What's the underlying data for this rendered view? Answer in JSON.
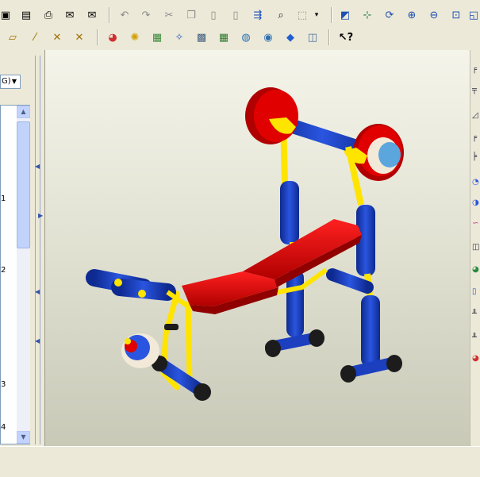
{
  "toolbar_top": {
    "items": [
      {
        "name": "new-window-icon",
        "glyph": "▣"
      },
      {
        "name": "save-icon",
        "glyph": "▤"
      },
      {
        "name": "print-icon",
        "glyph": "⎙"
      },
      {
        "name": "send-mail-icon",
        "glyph": "✉"
      },
      {
        "name": "email-attach-icon",
        "glyph": "✉"
      },
      {
        "name": "undo-icon",
        "glyph": "↶"
      },
      {
        "name": "redo-icon",
        "glyph": "↷"
      },
      {
        "name": "cut-icon",
        "glyph": "✂"
      },
      {
        "name": "copy-icon",
        "glyph": "❐"
      },
      {
        "name": "paste-icon",
        "glyph": "▯"
      },
      {
        "name": "paste-special-icon",
        "glyph": "▯"
      },
      {
        "name": "regenerate-icon",
        "glyph": "⇶"
      },
      {
        "name": "find-icon",
        "glyph": "⌕"
      },
      {
        "name": "select-box-icon",
        "glyph": "⬚"
      },
      {
        "name": "select-dropdown-icon",
        "glyph": "▾"
      },
      {
        "name": "redraw-icon",
        "glyph": "◩"
      },
      {
        "name": "spin-center-icon",
        "glyph": "⊹"
      },
      {
        "name": "orient-mode-icon",
        "glyph": "⟳"
      },
      {
        "name": "zoom-in-icon",
        "glyph": "⊕"
      },
      {
        "name": "zoom-out-icon",
        "glyph": "⊖"
      },
      {
        "name": "refit-icon",
        "glyph": "⊡"
      },
      {
        "name": "reorient-icon",
        "glyph": "◱"
      }
    ]
  },
  "toolbar_second": {
    "items": [
      {
        "name": "datum-plane-icon",
        "glyph": "▱"
      },
      {
        "name": "datum-axis-icon",
        "glyph": "⁄"
      },
      {
        "name": "datum-point-icon",
        "glyph": "✕"
      },
      {
        "name": "coordinate-system-icon",
        "glyph": "✕"
      },
      {
        "name": "appearance-icon",
        "glyph": "◕"
      },
      {
        "name": "light-icon",
        "glyph": "✺"
      },
      {
        "name": "scene-icon",
        "glyph": "▦"
      },
      {
        "name": "render-tool-icon",
        "glyph": "✧"
      },
      {
        "name": "render-window-icon",
        "glyph": "▩"
      },
      {
        "name": "room-editor-icon",
        "glyph": "▦"
      },
      {
        "name": "environment-icon",
        "glyph": "◍"
      },
      {
        "name": "photo-icon",
        "glyph": "◉"
      },
      {
        "name": "shading-icon",
        "glyph": "◆"
      },
      {
        "name": "model-display-icon",
        "glyph": "◫"
      },
      {
        "name": "context-help-icon",
        "glyph": "↖?"
      }
    ]
  },
  "left_panel": {
    "combo_value": "G)",
    "tree_numbers": [
      "1",
      "2",
      "3",
      "4"
    ]
  },
  "colors": {
    "red": "#e00000",
    "blue": "#1c3fc0",
    "yellow": "#ffe400",
    "black": "#1c1c1c"
  }
}
